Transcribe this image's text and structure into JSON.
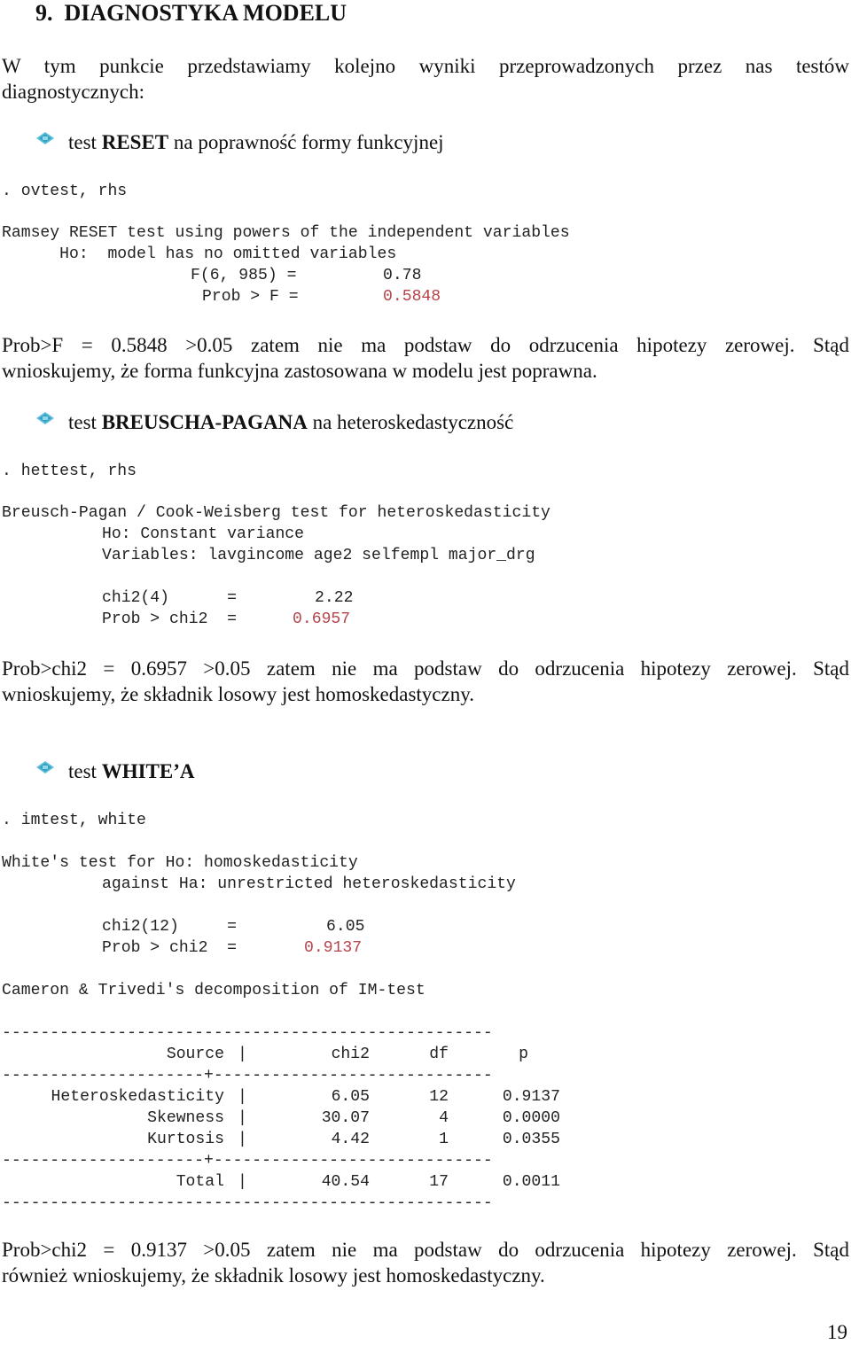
{
  "heading": "9.  DIAGNOSTYKA MODELU",
  "intro": {
    "line1": "W tym punkcie przedstawiamy kolejno wyniki przeprowadzonych przez nas testów",
    "line2": "diagnostycznych:"
  },
  "sections": {
    "reset": {
      "bullet_icon": "diamond-bullet-icon",
      "prefix": "test ",
      "bold": "RESET",
      "suffix": " na poprawność formy funkcyjnej",
      "command": ". ovtest, rhs",
      "output": {
        "line1": "Ramsey RESET test using powers of the independent variables",
        "line2": "      Ho:  model has no omitted variables",
        "stat_label": "F(6, 985) =",
        "stat_value": "0.78",
        "prob_label": "Prob > F =",
        "prob_value": "0.5848"
      },
      "conclusion_line1": "Prob>F = 0.5848 >0.05 zatem nie ma podstaw do odrzucenia hipotezy zerowej. Stąd",
      "conclusion_line2": "wnioskujemy, że forma funkcyjna zastosowana w modelu jest poprawna."
    },
    "breusch_pagan": {
      "bullet_icon": "diamond-bullet-icon",
      "prefix": "test ",
      "bold": "BREUSCHA-PAGANA",
      "suffix": " na heteroskedastyczność",
      "command": ". hettest, rhs",
      "output": {
        "line1": "Breusch-Pagan / Cook-Weisberg test for heteroskedasticity",
        "line2": "Ho: Constant variance",
        "line3": "Variables: lavgincome age2 selfempl major_drg",
        "stat_label": "chi2(4)      =",
        "stat_value": "2.22",
        "prob_label": "Prob > chi2  =",
        "prob_value": "0.6957"
      },
      "conclusion_line1": "Prob>chi2 = 0.6957 >0.05 zatem nie ma podstaw do odrzucenia hipotezy zerowej. Stąd",
      "conclusion_line2": "wnioskujemy, że składnik losowy jest homoskedastyczny."
    },
    "white": {
      "bullet_icon": "diamond-bullet-icon",
      "prefix": "test ",
      "bold": "WHITE’A",
      "suffix": "",
      "command": ". imtest, white",
      "output": {
        "line1": "White's test for Ho: homoskedasticity",
        "line2": "against Ha: unrestricted heteroskedasticity",
        "stat_label": "chi2(12)     =",
        "stat_value": "6.05",
        "prob_label": "Prob > chi2  =",
        "prob_value": "0.9137",
        "decomp_title": "Cameron & Trivedi's decomposition of IM-test"
      },
      "table": {
        "rule_top": "---------------------------------------------------",
        "headers": [
          "Source",
          "chi2",
          "df",
          "p"
        ],
        "rule_mid": "---------------------+-----------------------------",
        "rows": [
          {
            "source": "Heteroskedasticity",
            "chi2": "6.05",
            "df": "12",
            "p": "0.9137"
          },
          {
            "source": "Skewness",
            "chi2": "30.07",
            "df": "4",
            "p": "0.0000"
          },
          {
            "source": "Kurtosis",
            "chi2": "4.42",
            "df": "1",
            "p": "0.0355"
          }
        ],
        "total": {
          "source": "Total",
          "chi2": "40.54",
          "df": "17",
          "p": "0.0011"
        },
        "rule_bottom": "---------------------------------------------------"
      },
      "conclusion_line1": "Prob>chi2 = 0.9137 >0.05 zatem nie ma podstaw do odrzucenia hipotezy zerowej. Stąd",
      "conclusion_line2": "również wnioskujemy, że składnik losowy jest homoskedastyczny."
    }
  },
  "page_number": "19",
  "colors": {
    "pvalue_red": "#b5434a",
    "icon_cyan": "#4fb7d2"
  }
}
